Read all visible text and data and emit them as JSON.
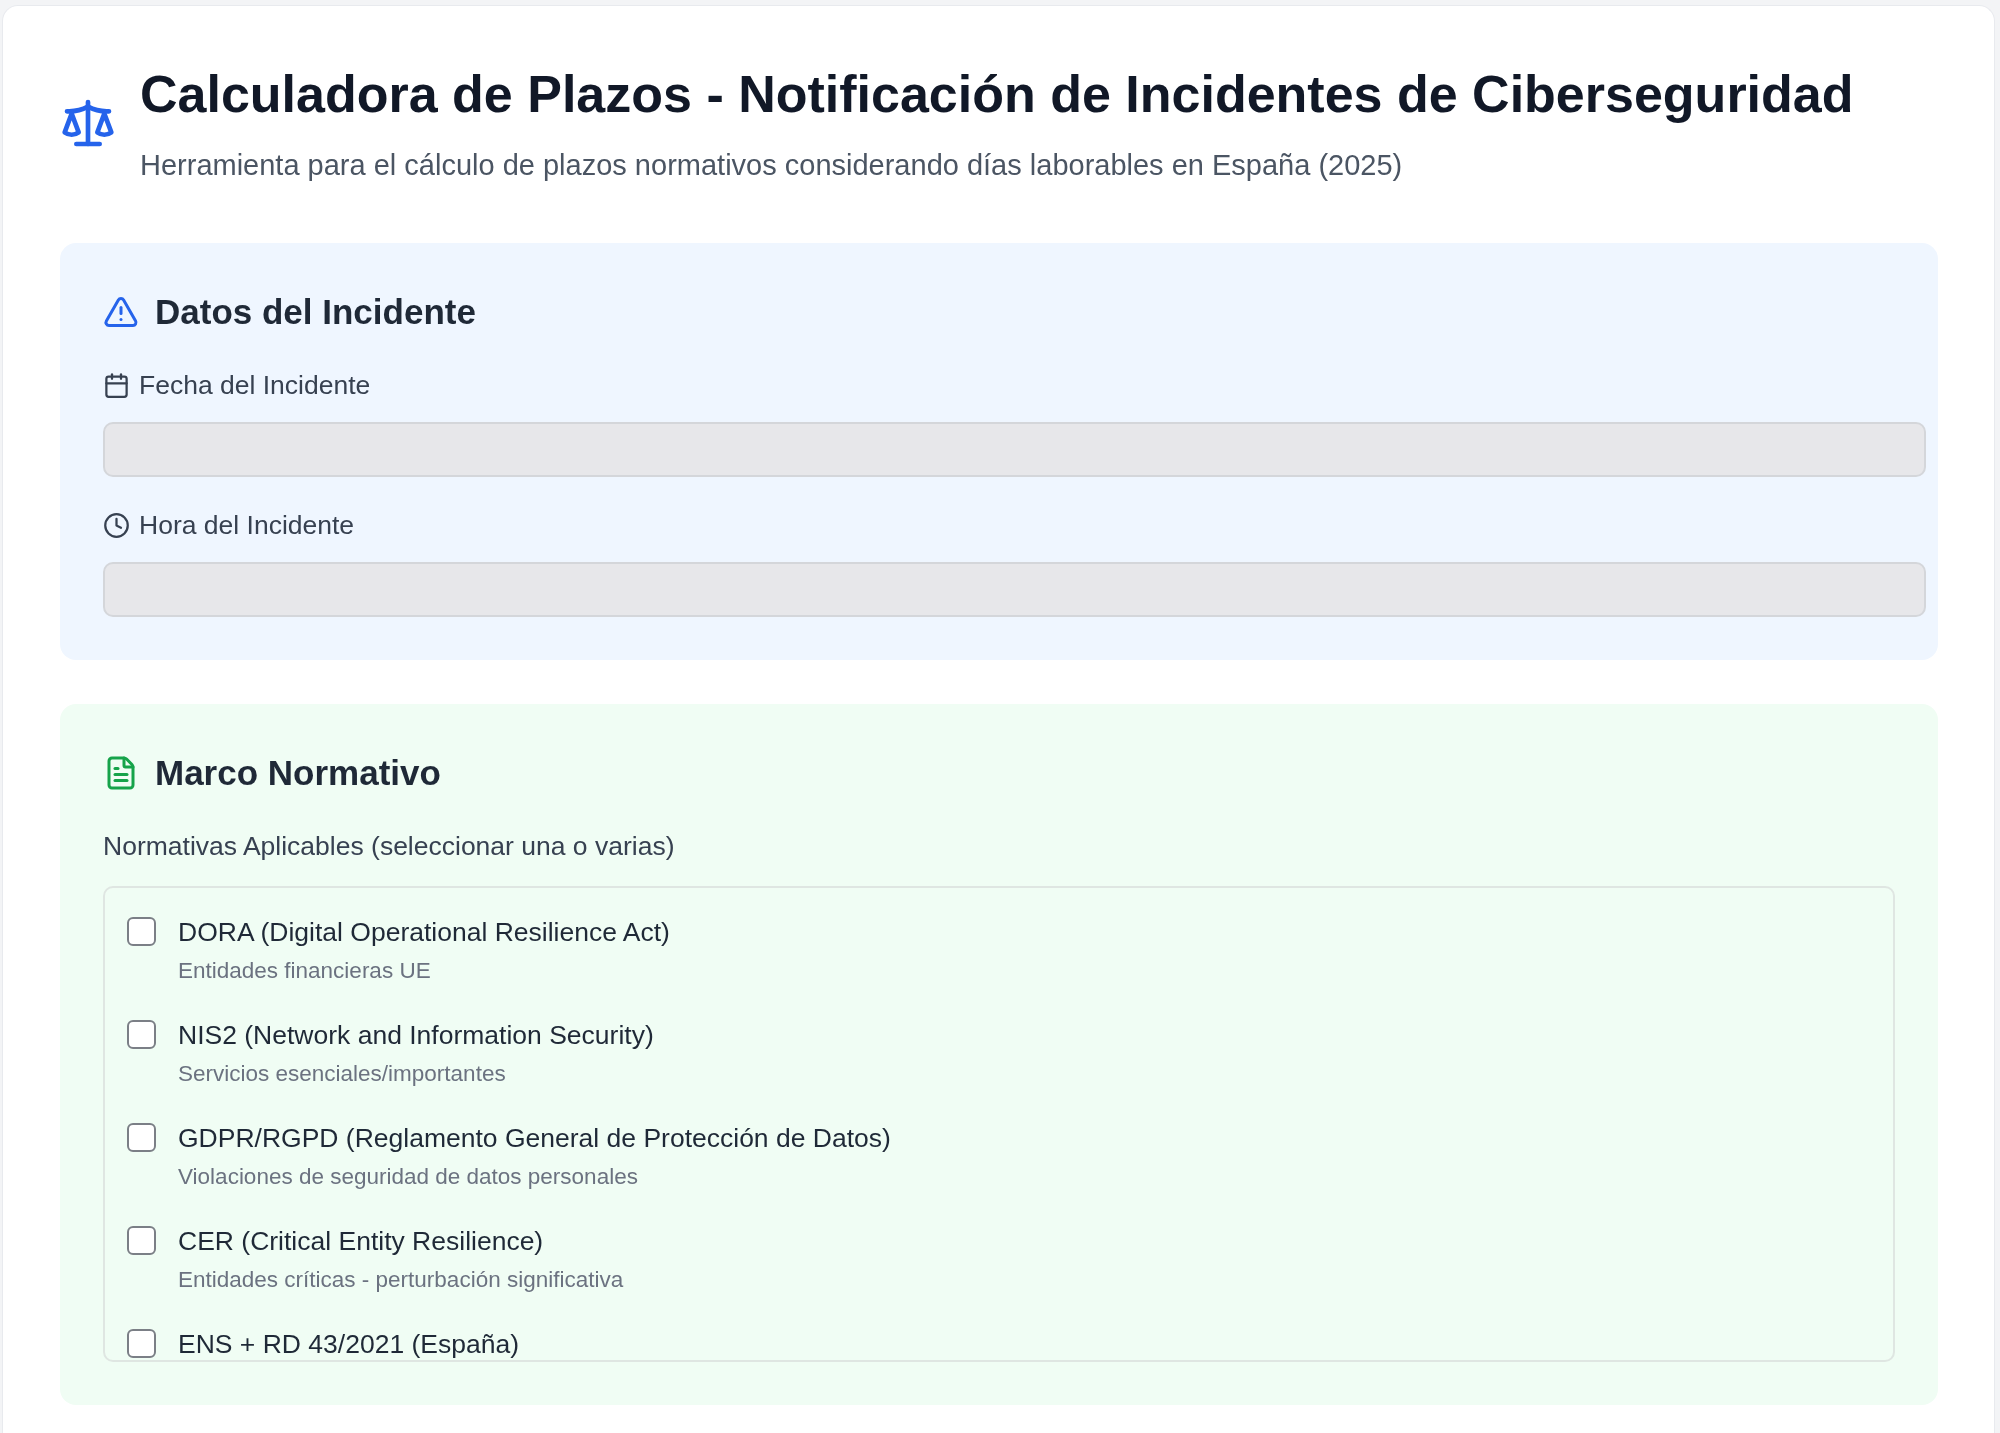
{
  "header": {
    "title": "Calculadora de Plazos - Notificación de Incidentes de Ciberseguridad",
    "subtitle": "Herramienta para el cálculo de plazos normativos considerando días laborables en España (2025)"
  },
  "incident_panel": {
    "heading": "Datos del Incidente",
    "fields": [
      {
        "kind": "date",
        "label": "Fecha del Incidente"
      },
      {
        "kind": "time",
        "label": "Hora del Incidente"
      }
    ]
  },
  "regulation_panel": {
    "heading": "Marco Normativo",
    "list_label": "Normativas Aplicables (seleccionar una o varias)",
    "options": [
      {
        "title": "DORA (Digital Operational Resilience Act)",
        "description": "Entidades financieras UE",
        "checked": false
      },
      {
        "title": "NIS2 (Network and Information Security)",
        "description": "Servicios esenciales/importantes",
        "checked": false
      },
      {
        "title": "GDPR/RGPD (Reglamento General de Protección de Datos)",
        "description": "Violaciones de seguridad de datos personales",
        "checked": false
      },
      {
        "title": "CER (Critical Entity Resilience)",
        "description": "Entidades críticas - perturbación significativa",
        "checked": false
      },
      {
        "title": "ENS + RD 43/2021 (España)",
        "checked": false
      }
    ]
  }
}
